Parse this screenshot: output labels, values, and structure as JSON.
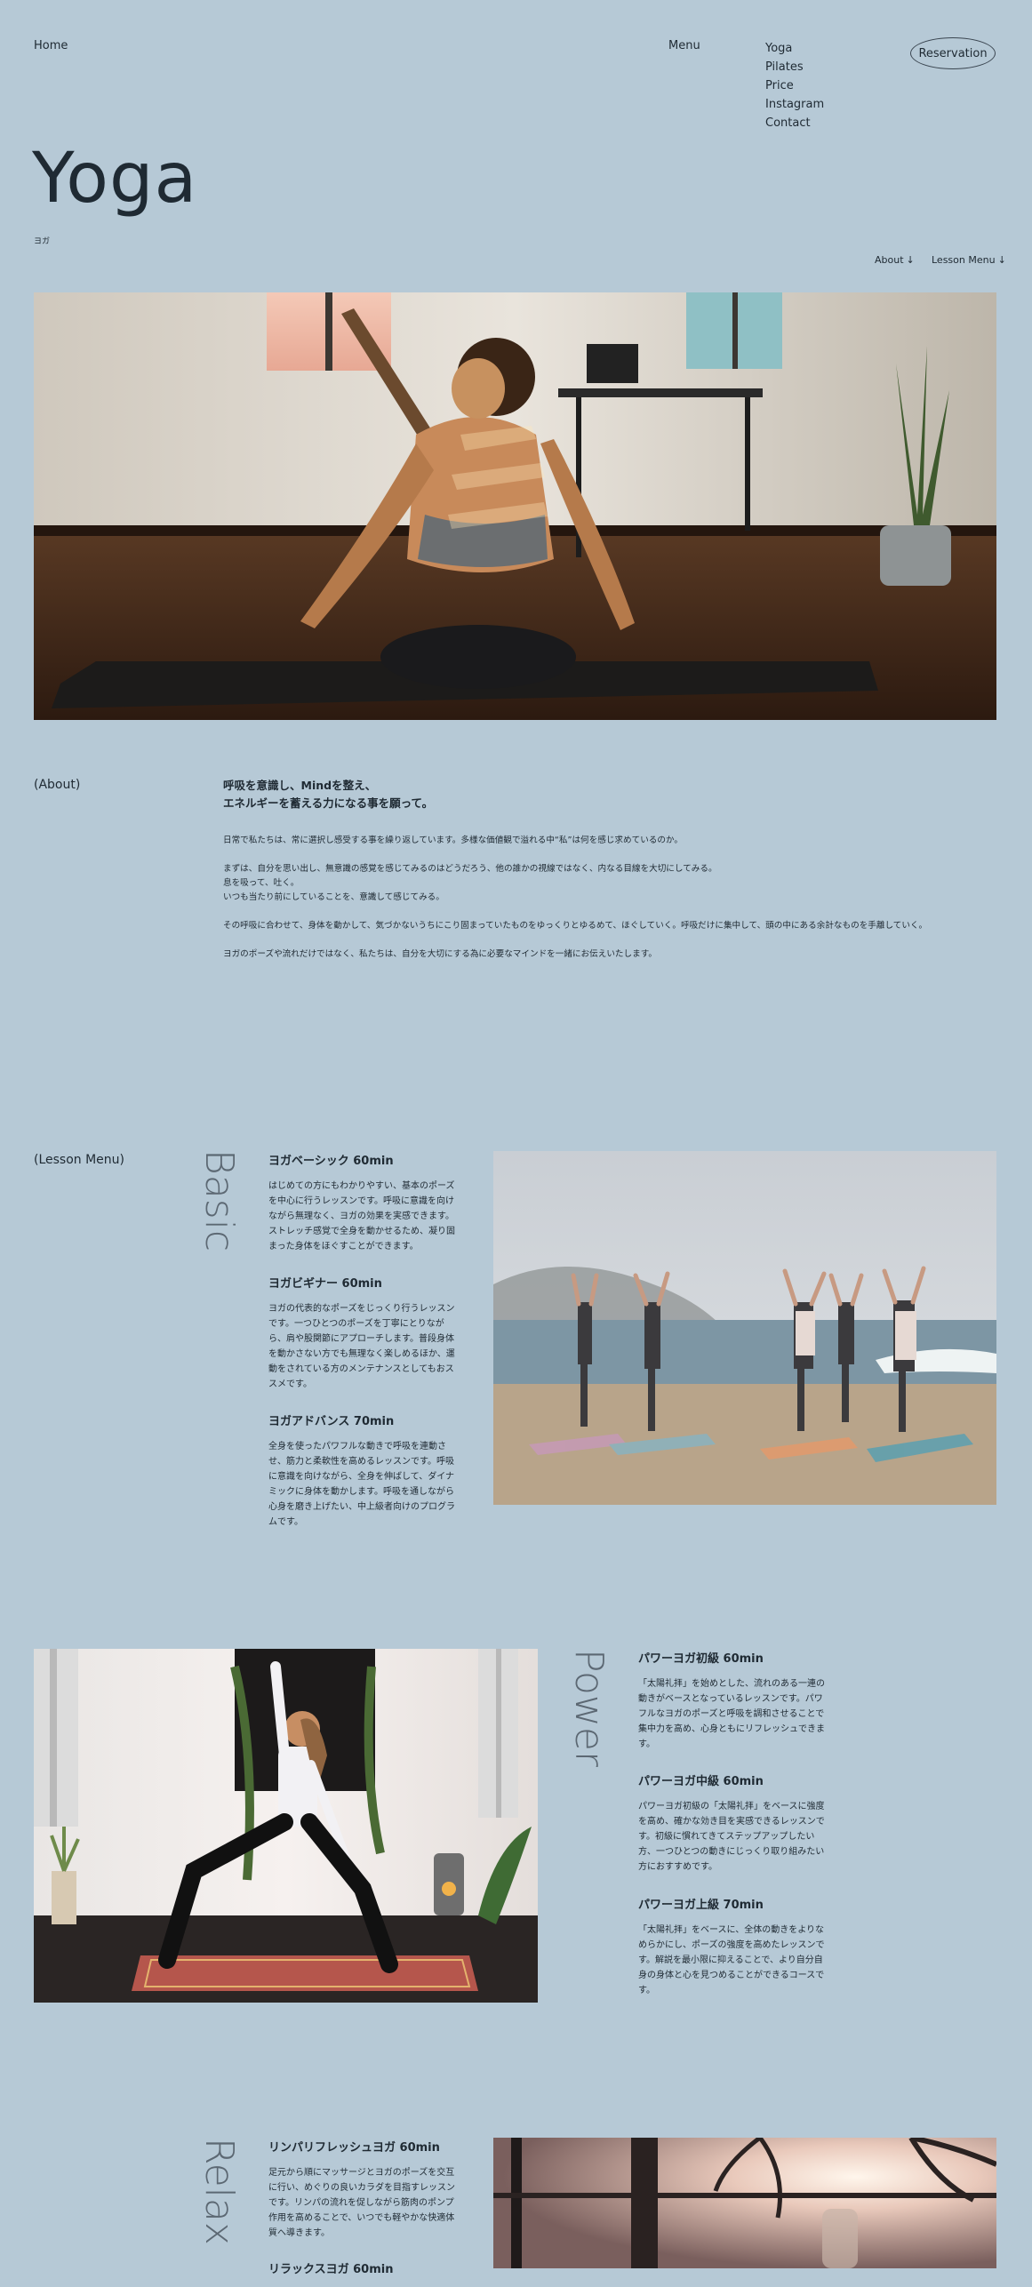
{
  "nav": {
    "home": "Home",
    "menu_label": "Menu",
    "items": [
      {
        "label": "Yoga"
      },
      {
        "label": "Pilates"
      },
      {
        "label": "Price"
      },
      {
        "label": "Instagram"
      },
      {
        "label": "Contact"
      }
    ],
    "reservation": "Reservation"
  },
  "hero": {
    "title": "Yoga",
    "subtitle": "ヨガ",
    "anchor_about": "About",
    "anchor_menu": "Lesson Menu",
    "arrow": "↓"
  },
  "about": {
    "label": "(About)",
    "heading_1": "呼吸を意識し、Mindを整え、",
    "heading_2": "エネルギーを蓄える力になる事を願って。",
    "paragraphs": [
      {
        "text": "日常で私たちは、常に選択し感受する事を繰り返しています。多様な価値観で溢れる中“私”は何を感じ求めているのか。"
      },
      {
        "text": "まずは、自分を思い出し、無意識の感覚を感じてみるのはどうだろう、他の誰かの視線ではなく、内なる目線を大切にしてみる。\n息を吸って、吐く。\nいつも当たり前にしていることを、意識して感じてみる。"
      },
      {
        "text": "その呼吸に合わせて、身体を動かして、気づかないうちにこり固まっていたものをゆっくりとゆるめて、ほぐしていく。呼吸だけに集中して、頭の中にある余計なものを手離していく。"
      },
      {
        "text": "ヨガのポーズや流れだけではなく、私たちは、自分を大切にする為に必要なマインドを一緒にお伝えいたします。"
      }
    ]
  },
  "lesson": {
    "label": "(Lesson Menu)",
    "basic": {
      "title": "Basic",
      "courses": [
        {
          "name": "ヨガベーシック 60min",
          "desc": "はじめての方にもわかりやすい、基本のポーズを中心に行うレッスンです。呼吸に意識を向けながら無理なく、ヨガの効果を実感できます。ストレッチ感覚で全身を動かせるため、凝り固まった身体をほぐすことができます。"
        },
        {
          "name": "ヨガビギナー 60min",
          "desc": "ヨガの代表的なポーズをじっくり行うレッスンです。一つひとつのポーズを丁寧にとりながら、肩や股関節にアプローチします。普段身体を動かさない方でも無理なく楽しめるほか、運動をされている方のメンテナンスとしてもおススメです。"
        },
        {
          "name": "ヨガアドバンス 70min",
          "desc": "全身を使ったパワフルな動きで呼吸を連動させ、筋力と柔軟性を高めるレッスンです。呼吸に意識を向けながら、全身を伸ばして、ダイナミックに身体を動かします。呼吸を通しながら心身を磨き上げたい、中上級者向けのプログラムです。"
        }
      ]
    },
    "power": {
      "title": "Power",
      "courses": [
        {
          "name": "パワーヨガ初級 60min",
          "desc": "「太陽礼拝」を始めとした、流れのある一連の動きがベースとなっているレッスンです。パワフルなヨガのポーズと呼吸を調和させることで集中力を高め、心身ともにリフレッシュできます。"
        },
        {
          "name": "パワーヨガ中級 60min",
          "desc": "パワーヨガ初級の「太陽礼拝」をベースに強度を高め、確かな効き目を実感できるレッスンです。初級に慣れてきてステップアップしたい方、一つひとつの動きにじっくり取り組みたい方におすすめです。"
        },
        {
          "name": "パワーヨガ上級 70min",
          "desc": "「太陽礼拝」をベースに、全体の動きをよりなめらかにし、ポーズの強度を高めたレッスンです。解説を最小限に抑えることで、より自分自身の身体と心を見つめることができるコースです。"
        }
      ]
    },
    "relax": {
      "title": "Relax",
      "courses": [
        {
          "name": "リンパリフレッシュヨガ 60min",
          "desc": "足元から順にマッサージとヨガのポーズを交互に行い、めぐりの良いカラダを目指すレッスンです。リンパの流れを促しながら筋肉のポンプ作用を高めることで、いつでも軽やかな快適体質へ導きます。"
        },
        {
          "name": "リラックスヨガ 60min",
          "desc": ""
        }
      ]
    }
  },
  "colors": {
    "background": "#b6c9d6",
    "text": "#1f2a33",
    "vertical_title": "#5c6873"
  }
}
